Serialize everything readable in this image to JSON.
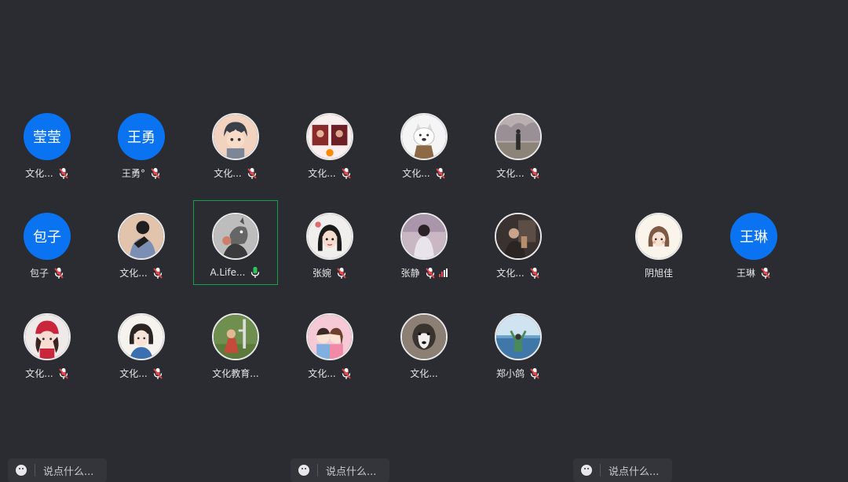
{
  "participants": [
    {
      "avatar_text": "莹莹",
      "name": "文化...",
      "mic": "muted"
    },
    {
      "avatar_text": "王勇",
      "name": "王勇°",
      "mic": "muted"
    },
    {
      "avatar_text": "",
      "avatar_icon": "boy-cartoon-avatar-icon",
      "name": "文化...",
      "mic": "muted"
    },
    {
      "avatar_text": "",
      "avatar_icon": "collage-photo-avatar-icon",
      "name": "文化...",
      "mic": "muted"
    },
    {
      "avatar_text": "",
      "avatar_icon": "white-dog-cartoon-avatar-icon",
      "name": "文化...",
      "mic": "muted"
    },
    {
      "avatar_text": "",
      "avatar_icon": "outdoor-person-avatar-icon",
      "name": "文化...",
      "mic": "muted"
    },
    {
      "avatar_text": "包子",
      "name": "包子",
      "mic": "muted"
    },
    {
      "avatar_text": "",
      "avatar_icon": "person-silhouette-avatar-icon",
      "name": "文化...",
      "mic": "muted"
    },
    {
      "avatar_text": "",
      "avatar_icon": "wolf-cartoon-avatar-icon",
      "name": "A.Life...",
      "mic": "on",
      "active": true
    },
    {
      "avatar_text": "",
      "avatar_icon": "girl-cartoon-avatar-icon",
      "name": "张婉",
      "mic": "muted"
    },
    {
      "avatar_text": "",
      "avatar_icon": "girl-photo-avatar-icon",
      "name": "张静",
      "mic": "muted",
      "signal": true
    },
    {
      "avatar_text": "",
      "avatar_icon": "dark-photo-avatar-icon",
      "name": "文化...",
      "mic": "muted"
    },
    {
      "avatar_text": "",
      "avatar_icon": "girl-sketch-avatar-icon",
      "name": "阴旭佳",
      "mic": "none"
    },
    {
      "avatar_text": "王琳",
      "name": "王琳",
      "mic": "muted"
    },
    {
      "avatar_text": "",
      "avatar_icon": "girl-red-hat-avatar-icon",
      "name": "文化...",
      "mic": "muted"
    },
    {
      "avatar_text": "",
      "avatar_icon": "girl-illustration-avatar-icon",
      "name": "文化...",
      "mic": "muted"
    },
    {
      "avatar_text": "",
      "avatar_icon": "child-outdoor-avatar-icon",
      "name": "文化教育...",
      "mic": "none"
    },
    {
      "avatar_text": "",
      "avatar_icon": "couple-cartoon-avatar-icon",
      "name": "文化...",
      "mic": "muted"
    },
    {
      "avatar_text": "",
      "avatar_icon": "husky-dog-avatar-icon",
      "name": "文化...",
      "mic": "none"
    },
    {
      "avatar_text": "",
      "avatar_icon": "sea-person-avatar-icon",
      "name": "郑小鸽",
      "mic": "muted"
    }
  ],
  "chat": {
    "placeholder": "说点什么..."
  },
  "colors": {
    "background": "#2b2c31",
    "text_avatar": "#0a73f2",
    "active_border": "#18a14b",
    "mic_muted": "#e5484d",
    "mic_on": "#2ec25b"
  }
}
